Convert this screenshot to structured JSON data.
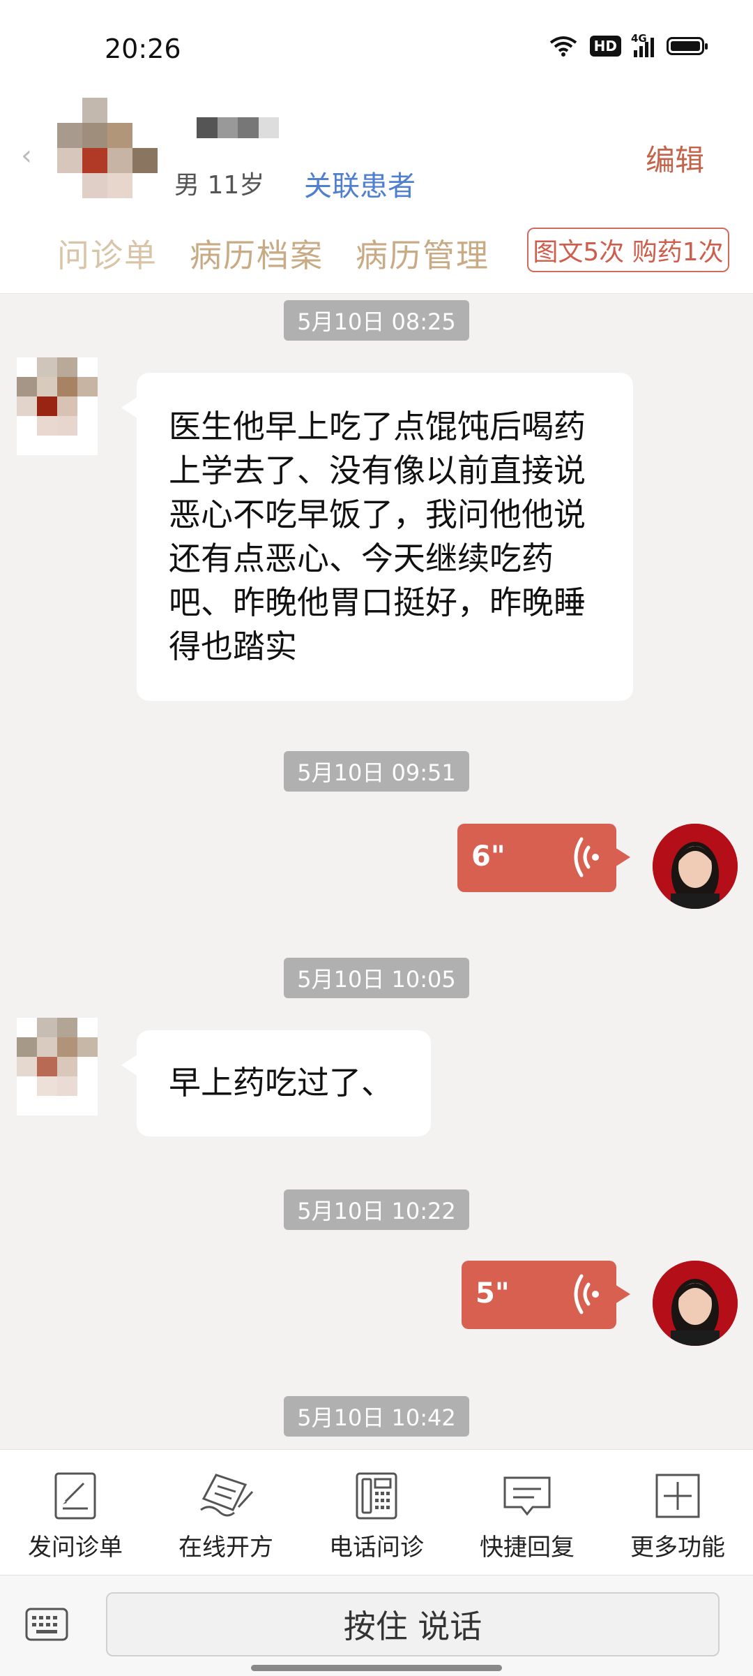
{
  "status_bar": {
    "time": "20:26",
    "hd": "HD",
    "network": "4G"
  },
  "header": {
    "patient_info": "男 11岁",
    "link_patient": "关联患者",
    "edit": "编辑",
    "tabs": [
      "问诊单",
      "病历档案",
      "病历管理"
    ],
    "service_badge": "图文5次 购药1次"
  },
  "messages": [
    {
      "timestamp": "5月10日 08:25",
      "sender": "patient",
      "type": "text",
      "lines": [
        "医生他早上吃了点馄饨后喝药",
        "上学去了、没有像以前直接说",
        "恶心不吃早饭了，我问他他说",
        "还有点恶心、今天继续吃药",
        "吧、昨晚他胃口挺好，昨晚睡",
        "得也踏实"
      ]
    },
    {
      "timestamp": "5月10日 09:51",
      "sender": "doctor",
      "type": "voice",
      "duration": "6\""
    },
    {
      "timestamp": "5月10日 10:05",
      "sender": "patient",
      "type": "text",
      "lines": [
        "早上药吃过了、"
      ]
    },
    {
      "timestamp": "5月10日 10:22",
      "sender": "doctor",
      "type": "voice",
      "duration": "5\""
    },
    {
      "timestamp": "5月10日 10:42"
    }
  ],
  "toolbar": [
    {
      "label": "发问诊单",
      "icon": "form-edit-icon"
    },
    {
      "label": "在线开方",
      "icon": "prescription-icon"
    },
    {
      "label": "电话问诊",
      "icon": "telephone-icon"
    },
    {
      "label": "快捷回复",
      "icon": "quick-reply-icon"
    },
    {
      "label": "更多功能",
      "icon": "plus-box-icon"
    }
  ],
  "input_bar": {
    "talk_button": "按住 说话",
    "keyboard_icon": "keyboard-icon"
  },
  "colors": {
    "accent": "#d86050",
    "link": "#4f7fd0",
    "tab": "#c8ab85"
  }
}
